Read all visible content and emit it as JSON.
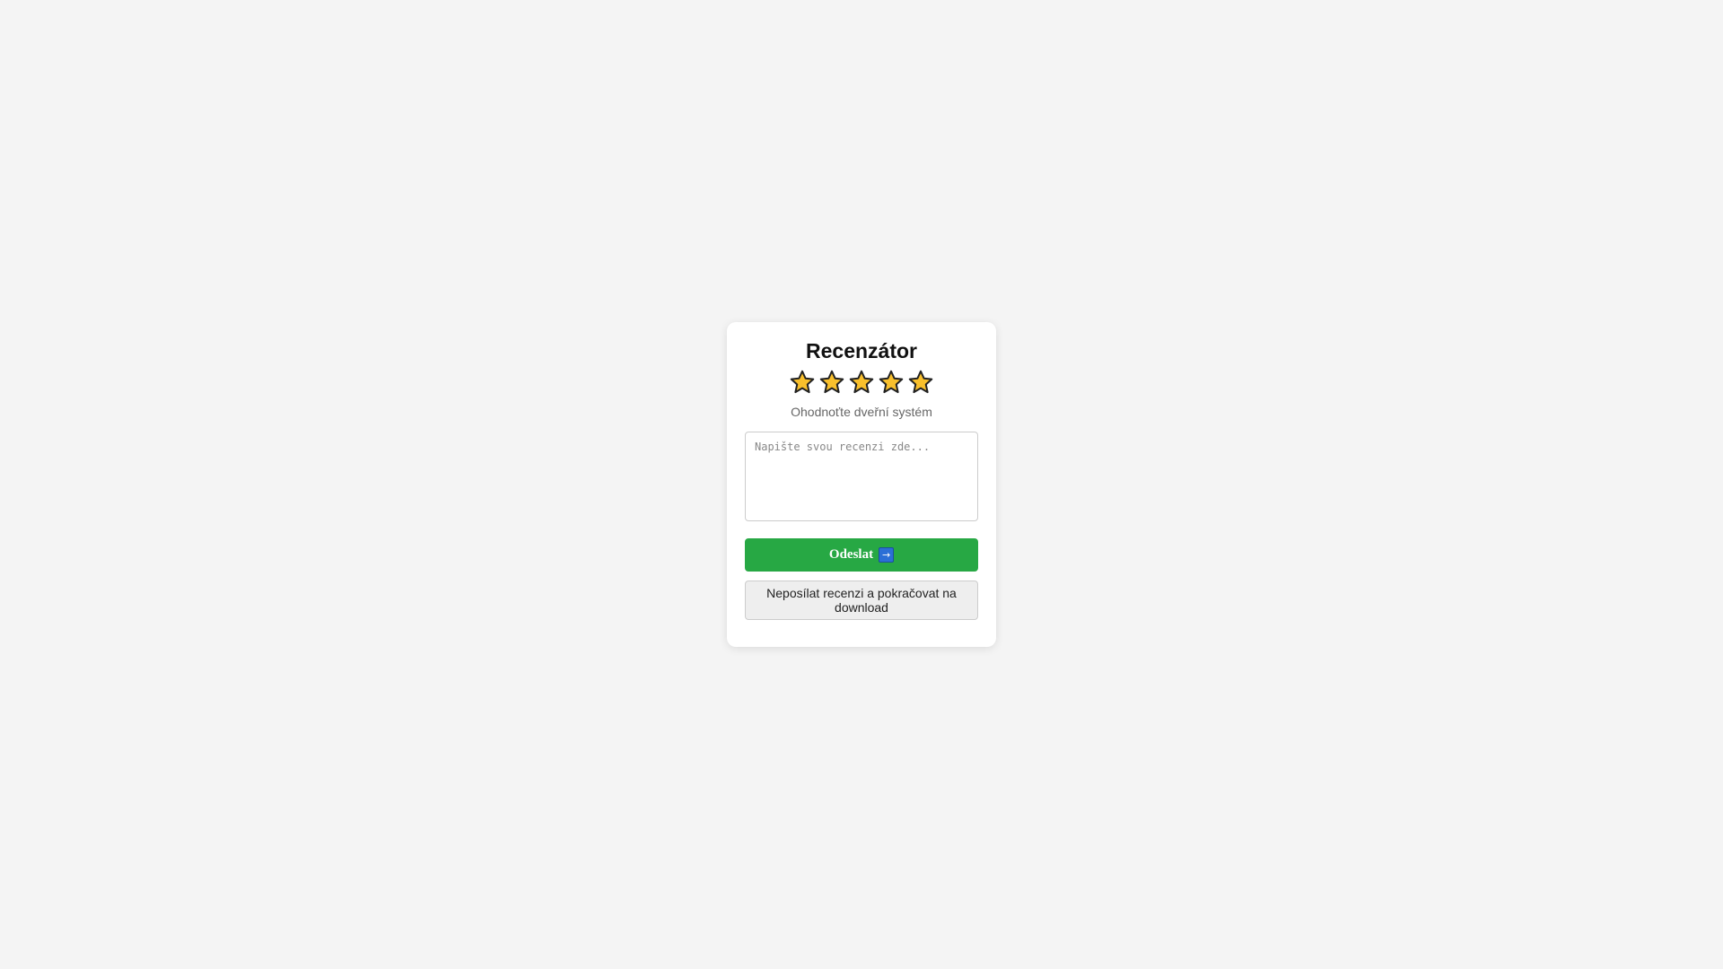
{
  "card": {
    "title": "Recenzátor",
    "subtitle": "Ohodnoťte dveřní systém",
    "stars": [
      {
        "icon": "star-icon"
      },
      {
        "icon": "star-icon"
      },
      {
        "icon": "star-icon"
      },
      {
        "icon": "star-icon"
      },
      {
        "icon": "star-icon"
      }
    ],
    "rating": 5,
    "max_rating": 5,
    "review": {
      "placeholder": "Napište svou recenzi zde...",
      "value": ""
    },
    "submit_label": "Odeslat",
    "submit_icon": "arrow-right-icon",
    "submit_icon_glyph": "→",
    "skip_label": "Neposílat recenzi a pokračovat na download"
  },
  "colors": {
    "background": "#f4f4f4",
    "card": "#ffffff",
    "star_fill": "#f9c02c",
    "star_stroke": "#222222",
    "submit": "#27a844",
    "skip": "#eeeeee"
  }
}
